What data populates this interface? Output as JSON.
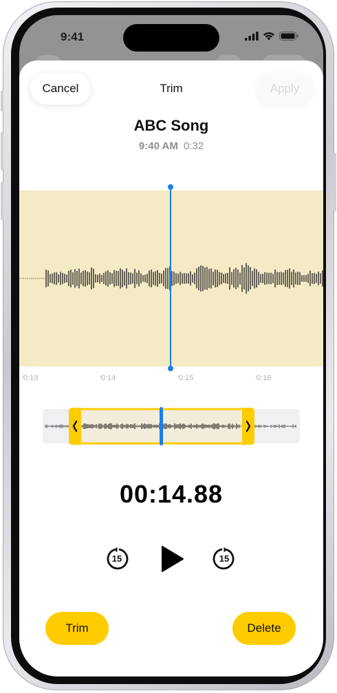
{
  "status": {
    "time": "9:41"
  },
  "header": {
    "cancel_label": "Cancel",
    "title": "Trim",
    "apply_label": "Apply"
  },
  "recording": {
    "name": "ABC Song",
    "recorded_time": "9:40 AM",
    "duration": "0:32"
  },
  "timeline": {
    "ticks": [
      "0:13",
      "0:14",
      "0:15",
      "0:16"
    ]
  },
  "playback": {
    "position": "00:14.88",
    "skip_back_seconds": "15",
    "skip_forward_seconds": "15"
  },
  "actions": {
    "trim_label": "Trim",
    "delete_label": "Delete"
  },
  "colors": {
    "accent_yellow": "#FFCC00",
    "playhead_blue": "#1C7CF0",
    "waveform_bg": "#F4EAC6"
  },
  "icons": {
    "skip_back": "gobackward-15-icon",
    "play": "play-icon",
    "skip_forward": "goforward-15-icon",
    "signal": "cellular-signal-icon",
    "wifi": "wifi-icon",
    "battery": "battery-icon"
  }
}
